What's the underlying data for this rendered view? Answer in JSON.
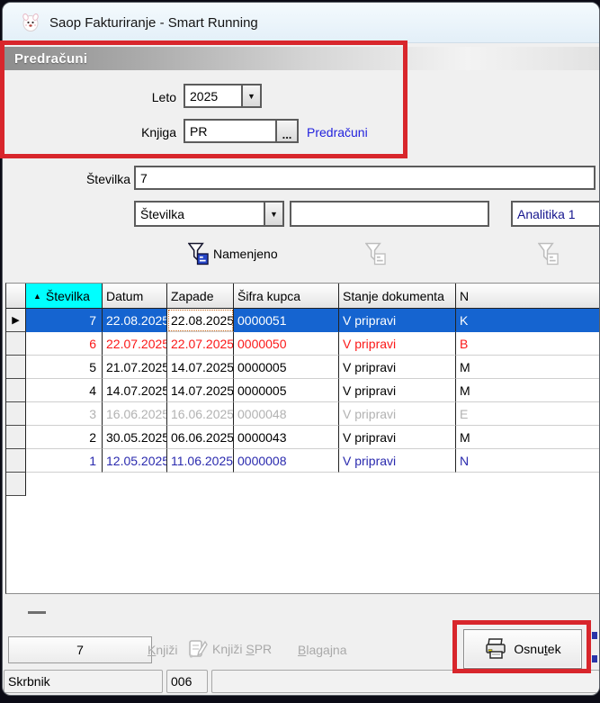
{
  "window": {
    "title": "Saop Fakturiranje - Smart Running"
  },
  "panel": {
    "caption": "Predračuni"
  },
  "form": {
    "leto_label": "Leto",
    "leto_value": "2025",
    "knjiga_label": "Knjiga",
    "knjiga_value": "PR",
    "knjiga_link": "Predračuni",
    "stevilka_label": "Številka",
    "stevilka_value": "7",
    "filter_field_value": "Številka",
    "filter_text_value": "",
    "analitika_value": "Analitika 1",
    "namenjeno_label": "Namenjeno"
  },
  "glyphs": {
    "sort_asc": "▲",
    "row_pointer": "▶",
    "dropdown": "▼",
    "ellipsis": "...",
    "splitter": ""
  },
  "table": {
    "columns": [
      "Številka",
      "Datum",
      "Zapade",
      "Šifra kupca",
      "Stanje dokumenta",
      "N"
    ],
    "rows": [
      {
        "stevilka": "7",
        "datum": "22.08.2025",
        "zapade": "22.08.2025",
        "sifra": "0000051",
        "stanje": "V pripravi",
        "n": "K",
        "style": "selected"
      },
      {
        "stevilka": "6",
        "datum": "22.07.2025",
        "zapade": "22.07.2025",
        "sifra": "0000050",
        "stanje": "V pripravi",
        "n": "B",
        "style": "red"
      },
      {
        "stevilka": "5",
        "datum": "21.07.2025",
        "zapade": "14.07.2025",
        "sifra": "0000005",
        "stanje": "V pripravi",
        "n": "M",
        "style": "normal"
      },
      {
        "stevilka": "4",
        "datum": "14.07.2025",
        "zapade": "14.07.2025",
        "sifra": "0000005",
        "stanje": "V pripravi",
        "n": "M",
        "style": "normal"
      },
      {
        "stevilka": "3",
        "datum": "16.06.2025",
        "zapade": "16.06.2025",
        "sifra": "0000048",
        "stanje": "V pripravi",
        "n": "E",
        "style": "gray"
      },
      {
        "stevilka": "2",
        "datum": "30.05.2025",
        "zapade": "06.06.2025",
        "sifra": "0000043",
        "stanje": "V pripravi",
        "n": "M",
        "style": "normal"
      },
      {
        "stevilka": "1",
        "datum": "12.05.2025",
        "zapade": "11.06.2025",
        "sifra": "0000008",
        "stanje": "V pripravi",
        "n": "N",
        "style": "navy"
      }
    ]
  },
  "footer": {
    "count": "7",
    "buttons": [
      {
        "label": "Knjiži",
        "underline": 0,
        "state": "disabled"
      },
      {
        "label": "Knjiži SPR",
        "underline": 7,
        "state": "disabled"
      },
      {
        "label": "Blagajna",
        "underline": 0,
        "state": "disabled"
      },
      {
        "label": "Osnutek",
        "underline": 4,
        "state": "enabled"
      }
    ]
  },
  "statusbar": {
    "user": "Skrbnik",
    "code": "006",
    "extra": ""
  },
  "colors": {
    "annotation_red": "#d8262c",
    "selected_row": "#1564d0",
    "sorted_header": "#00ffff",
    "link_blue": "#2222dd",
    "row_red": "#fb1818",
    "row_gray": "#b2b2b2",
    "row_navy": "#2a2aae"
  }
}
